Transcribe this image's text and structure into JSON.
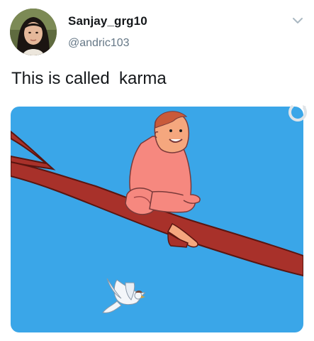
{
  "tweet": {
    "display_name": "Sanjay_grg10",
    "handle": "@andric103",
    "text": "This is called  karma"
  },
  "icons": {
    "menu": "chevron-down-icon",
    "overlay": "refresh-icon"
  },
  "colors": {
    "sky": "#3aa6e8",
    "branch": "#a8312a",
    "skin": "#f5a77e",
    "shirt": "#f6887f",
    "handle_gray": "#657786"
  }
}
